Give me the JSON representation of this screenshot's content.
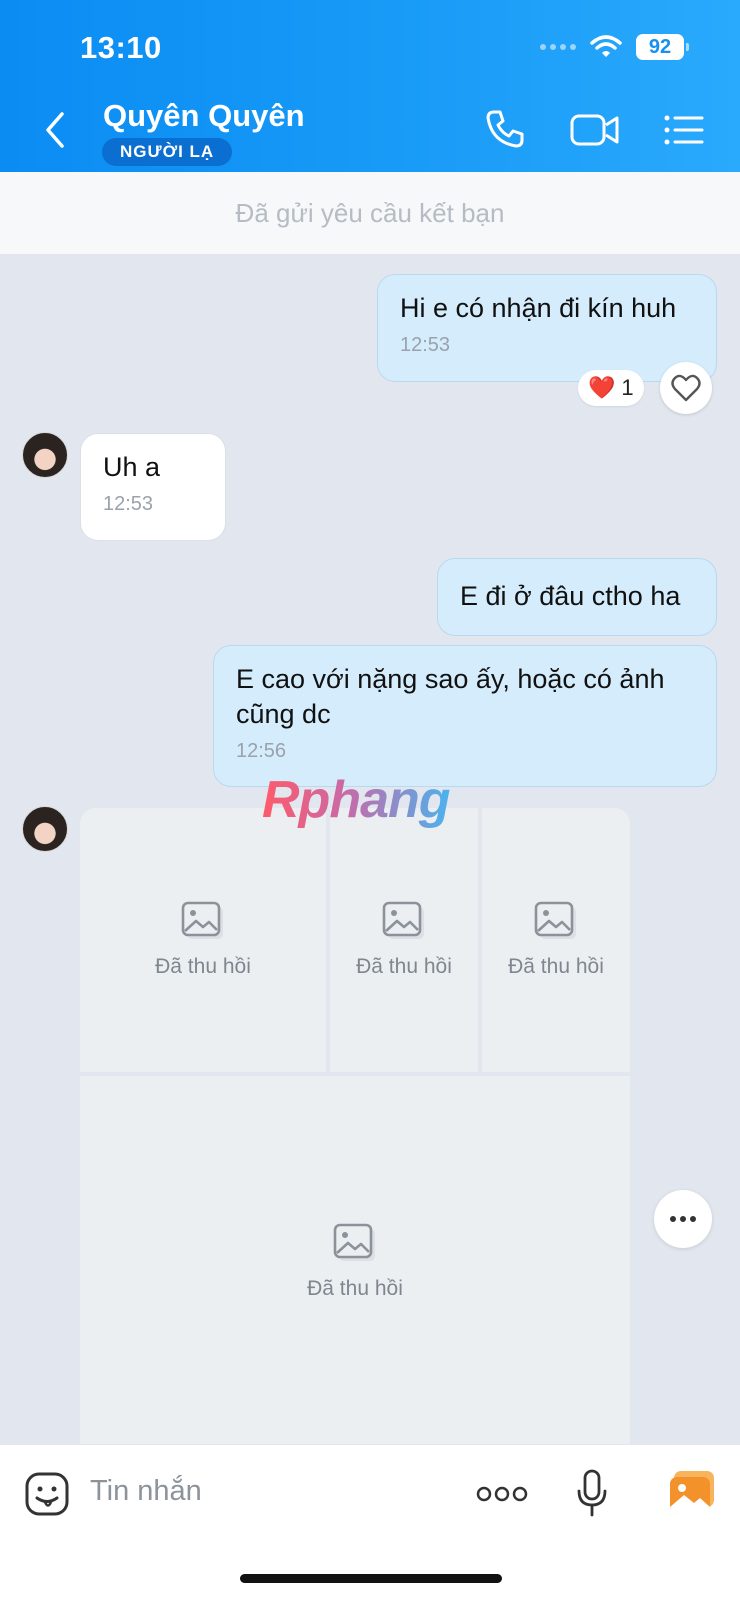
{
  "status_bar": {
    "time": "13:10",
    "battery": "92"
  },
  "header": {
    "contact_name": "Quyên Quyên",
    "badge": "NGƯỜI LẠ"
  },
  "friend_request": {
    "text": "Đã gửi yêu cầu kết bạn"
  },
  "messages": [
    {
      "direction": "out",
      "text": "Hi e có nhận đi kín huh",
      "time": "12:53",
      "reaction": {
        "emoji": "❤️",
        "count": "1"
      }
    },
    {
      "direction": "in",
      "text": "Uh a",
      "time": "12:53"
    },
    {
      "direction": "out",
      "text": "E đi ở đâu ctho ha"
    },
    {
      "direction": "out",
      "text": "E cao với nặng sao ấy, hoặc có ảnh cũng dc",
      "time": "12:56"
    }
  ],
  "recalled_photos": [
    {
      "label": "Đã thu hồi"
    },
    {
      "label": "Đã thu hồi"
    },
    {
      "label": "Đã thu hồi"
    },
    {
      "label": "Đã thu hồi"
    }
  ],
  "watermark": "Rphang",
  "input": {
    "placeholder": "Tin nhắn"
  },
  "colors": {
    "header_blue": "#0a8cf3",
    "outgoing_bubble": "#d4ecfb",
    "chat_background": "#e2e7ef"
  }
}
